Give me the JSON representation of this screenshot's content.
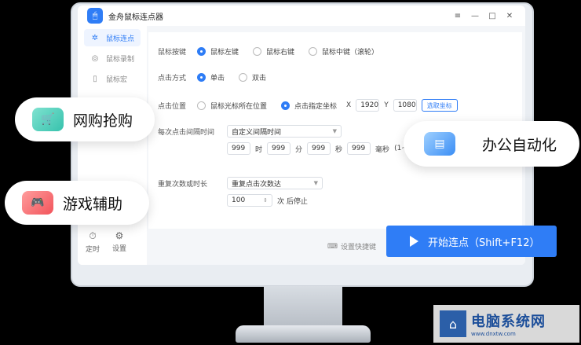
{
  "app": {
    "title": "金舟鼠标连点器",
    "logo_icon": "mouse-icon"
  },
  "window_controls": [
    "≡",
    "—",
    "□",
    "✕"
  ],
  "sidebar": {
    "items": [
      {
        "label": "鼠标连点",
        "icon": "cursor-click-icon",
        "active": true
      },
      {
        "label": "鼠标录制",
        "icon": "record-icon",
        "active": false
      },
      {
        "label": "鼠标宏",
        "icon": "mouse-icon",
        "active": false
      }
    ],
    "bottom": [
      {
        "label": "定时",
        "icon": "timer-icon"
      },
      {
        "label": "设置",
        "icon": "settings-icon"
      }
    ]
  },
  "form": {
    "button": {
      "label": "鼠标按键",
      "options": [
        "鼠标左键",
        "鼠标右键",
        "鼠标中键（滚轮）"
      ],
      "selected": 0
    },
    "method": {
      "label": "点击方式",
      "options": [
        "单击",
        "双击"
      ],
      "selected": 0
    },
    "position": {
      "label": "点击位置",
      "options": [
        "鼠标光标所在位置",
        "点击指定坐标"
      ],
      "selected": 1,
      "x_label": "X",
      "x_value": "1920",
      "y_label": "Y",
      "y_value": "1080",
      "pick_label": "选取坐标"
    },
    "interval": {
      "label": "每次点击间隔时间",
      "mode": "自定义间隔时间",
      "h": "999",
      "h_unit": "时",
      "m": "999",
      "m_unit": "分",
      "s": "999",
      "s_unit": "秒",
      "ms": "999",
      "ms_unit": "毫秒",
      "hint": "(1~10"
    },
    "repeat": {
      "label": "重复次数或时长",
      "mode": "重复点击次数达",
      "count": "100",
      "suffix": "次 后停止"
    }
  },
  "footer": {
    "hotkey_label": "设置快捷键",
    "start_label": "开始连点（Shift+F12）"
  },
  "pills": [
    {
      "label": "网购抢购",
      "icon": "shopping-cart-icon"
    },
    {
      "label": "游戏辅助",
      "icon": "gamepad-icon"
    },
    {
      "label": "办公自动化",
      "icon": "document-icon"
    }
  ],
  "watermark": {
    "name": "电脑系统网",
    "url": "www.dnxtw.com"
  }
}
